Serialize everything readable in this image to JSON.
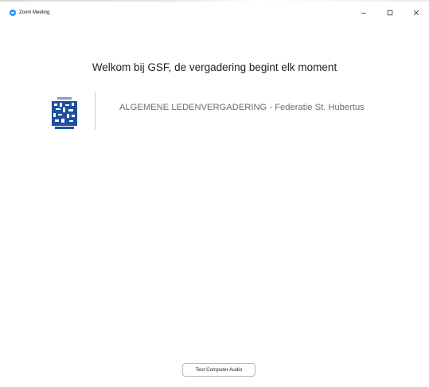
{
  "window": {
    "title": "Zoom Meeting",
    "controls": {
      "minimize_icon": "minimize-icon",
      "maximize_icon": "maximize-icon",
      "close_icon": "close-icon"
    }
  },
  "main": {
    "welcome_message": "Welkom bij GSF, de vergadering begint elk moment",
    "meeting_topic": "ALGEMENE LEDENVERGADERING - Federatie St. Hubertus",
    "logo_icon": "organization-logo",
    "test_audio_label": "Test Computer Audio"
  },
  "colors": {
    "zoom_blue": "#2d8cff",
    "logo_blue": "#1f4f9e",
    "topic_text": "#6e6e6e",
    "welcome_text": "#222222"
  }
}
